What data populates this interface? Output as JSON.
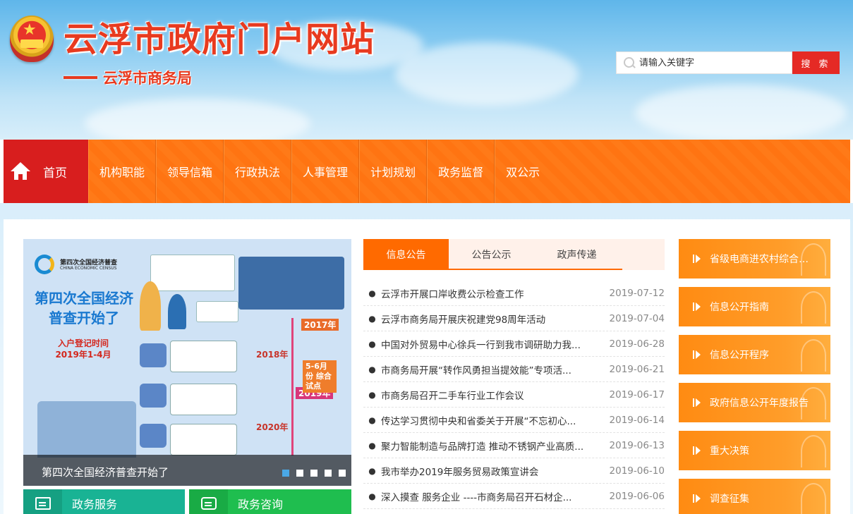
{
  "header": {
    "site_title": "云浮市政府门户网站",
    "sub_title": "云浮市商务局",
    "search": {
      "placeholder": "请输入关键字",
      "button_label": "搜 索"
    }
  },
  "nav": {
    "home_label": "首页",
    "items": [
      "机构职能",
      "领导信箱",
      "行政执法",
      "人事管理",
      "计划规划",
      "政务监督",
      "双公示"
    ]
  },
  "carousel": {
    "caption": "第四次全国经济普查开始了",
    "slide_count": 5,
    "active_index": 0,
    "poster": {
      "logo_cn": "第四次全国经济普查",
      "logo_en": "CHINA ECONOMIC CENSUS",
      "headline": "第四次全国经济普查开始了",
      "registration_label": "入户登记时间",
      "registration_period": "2019年1-4月",
      "years": [
        "2017年",
        "2018年",
        "2019年",
        "2020年"
      ],
      "pilot_label": "5-6月份 综合试点"
    }
  },
  "services": [
    {
      "label": "政务服务",
      "color": "#19b394"
    },
    {
      "label": "政务咨询",
      "color": "#1fbe4f"
    }
  ],
  "news": {
    "tabs": [
      "信息公告",
      "公告公示",
      "政声传递"
    ],
    "active_tab": 0,
    "items": [
      {
        "title": "云浮市开展口岸收费公示检查工作",
        "date": "2019-07-12"
      },
      {
        "title": "云浮市商务局开展庆祝建党98周年活动",
        "date": "2019-07-04"
      },
      {
        "title": "中国对外贸易中心徐兵一行到我市调研助力我...",
        "date": "2019-06-28"
      },
      {
        "title": "市商务局开展“转作风勇担当提效能”专项活...",
        "date": "2019-06-21"
      },
      {
        "title": "市商务局召开二手车行业工作会议",
        "date": "2019-06-17"
      },
      {
        "title": "传达学习贯彻中央和省委关于开展“不忘初心...",
        "date": "2019-06-14"
      },
      {
        "title": "聚力智能制造与品牌打造 推动不锈钢产业高质...",
        "date": "2019-06-13"
      },
      {
        "title": "我市举办2019年服务贸易政策宣讲会",
        "date": "2019-06-10"
      },
      {
        "title": "深入摸查 服务企业 ----市商务局召开石材企...",
        "date": "2019-06-06"
      }
    ]
  },
  "sidebar": {
    "items": [
      "省级电商进农村综合示...",
      "信息公开指南",
      "信息公开程序",
      "政府信息公开年度报告",
      "重大决策",
      "调查征集"
    ]
  },
  "colors": {
    "nav_orange": "#ff7412",
    "home_red": "#d81e1e",
    "search_red": "#e52a25",
    "tab_orange": "#ff6a00",
    "side_orange": "#ff8b12"
  }
}
